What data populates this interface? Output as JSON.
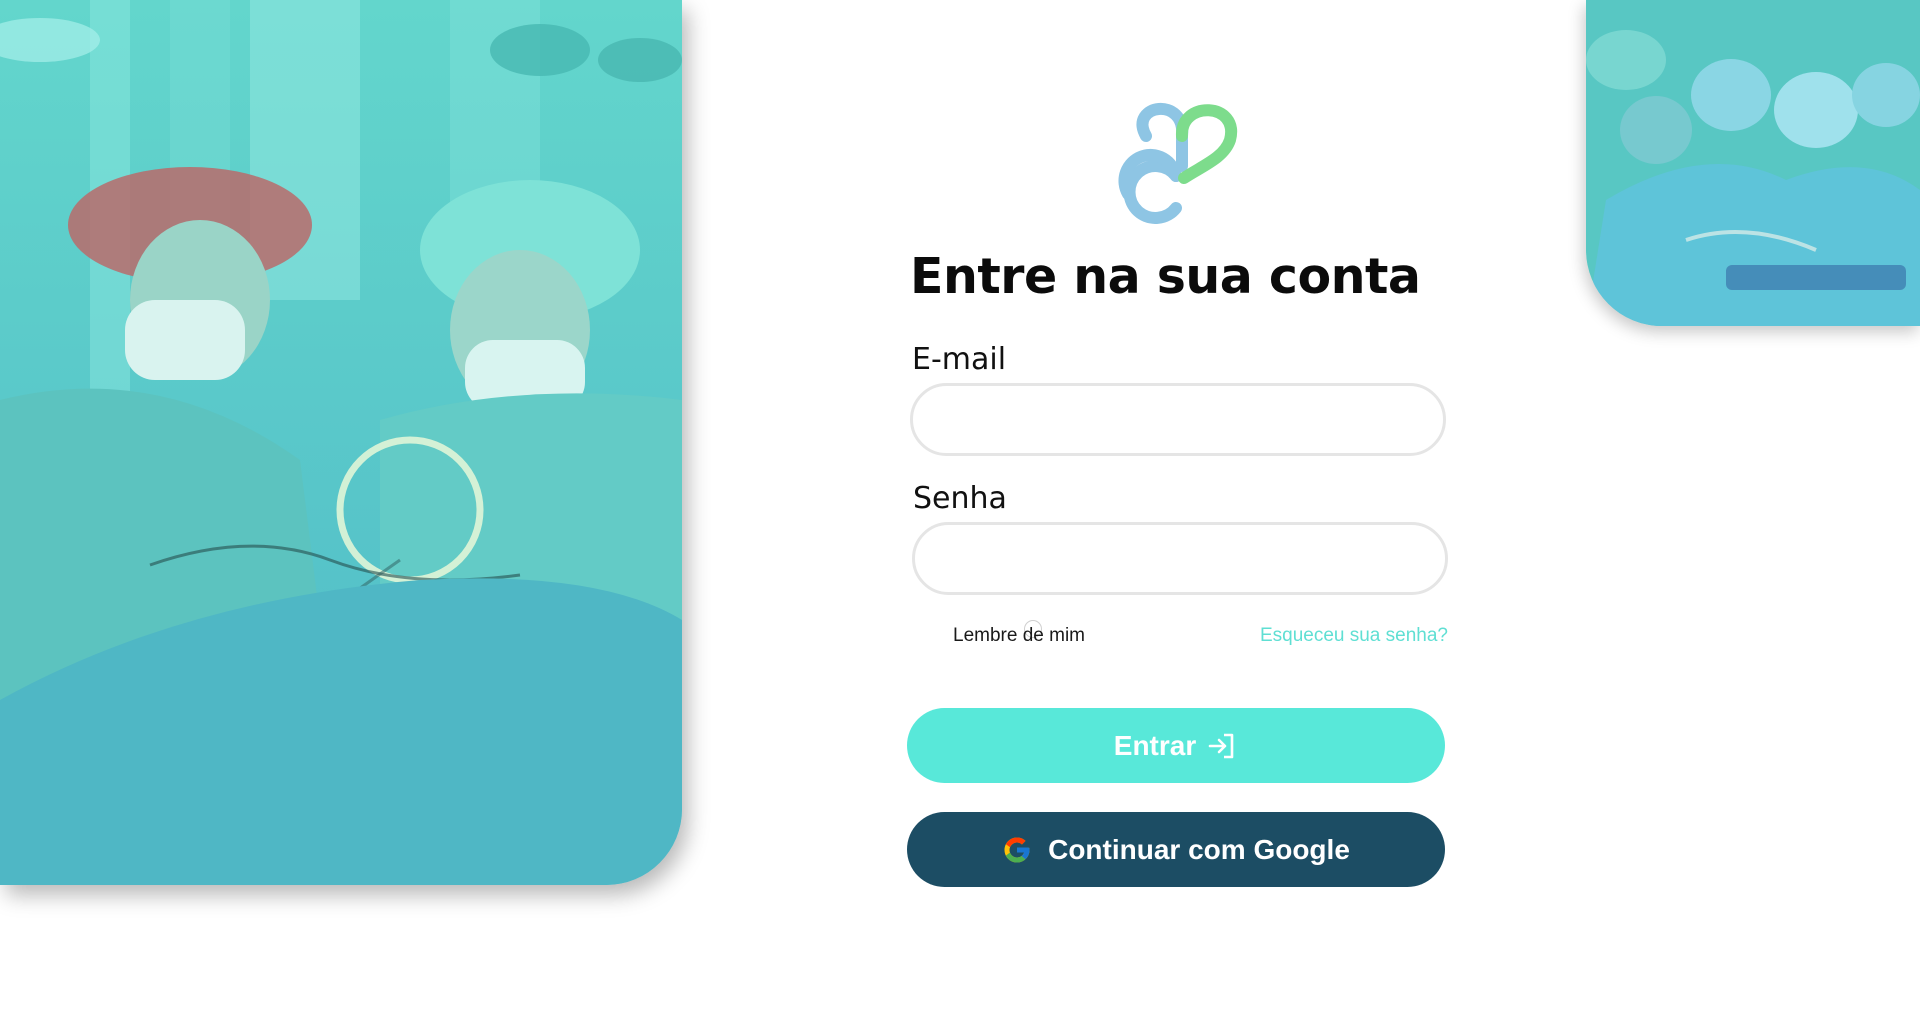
{
  "brand": {
    "logo_icon": "heart-s-logo-icon",
    "colors": {
      "blue": "#8ec5e4",
      "green": "#7ddc8c",
      "accent": "#58e8d9",
      "dark": "#1c4d64"
    }
  },
  "login": {
    "title": "Entre na sua conta",
    "email_label": "E-mail",
    "email_value": "",
    "password_label": "Senha",
    "password_value": "",
    "remember_label": "Lembre de mim",
    "forgot_label": "Esqueceu sua senha?",
    "submit_label": "Entrar",
    "submit_icon": "login-arrow-icon",
    "google_label": "Continuar com Google",
    "google_icon": "google-g-icon"
  }
}
